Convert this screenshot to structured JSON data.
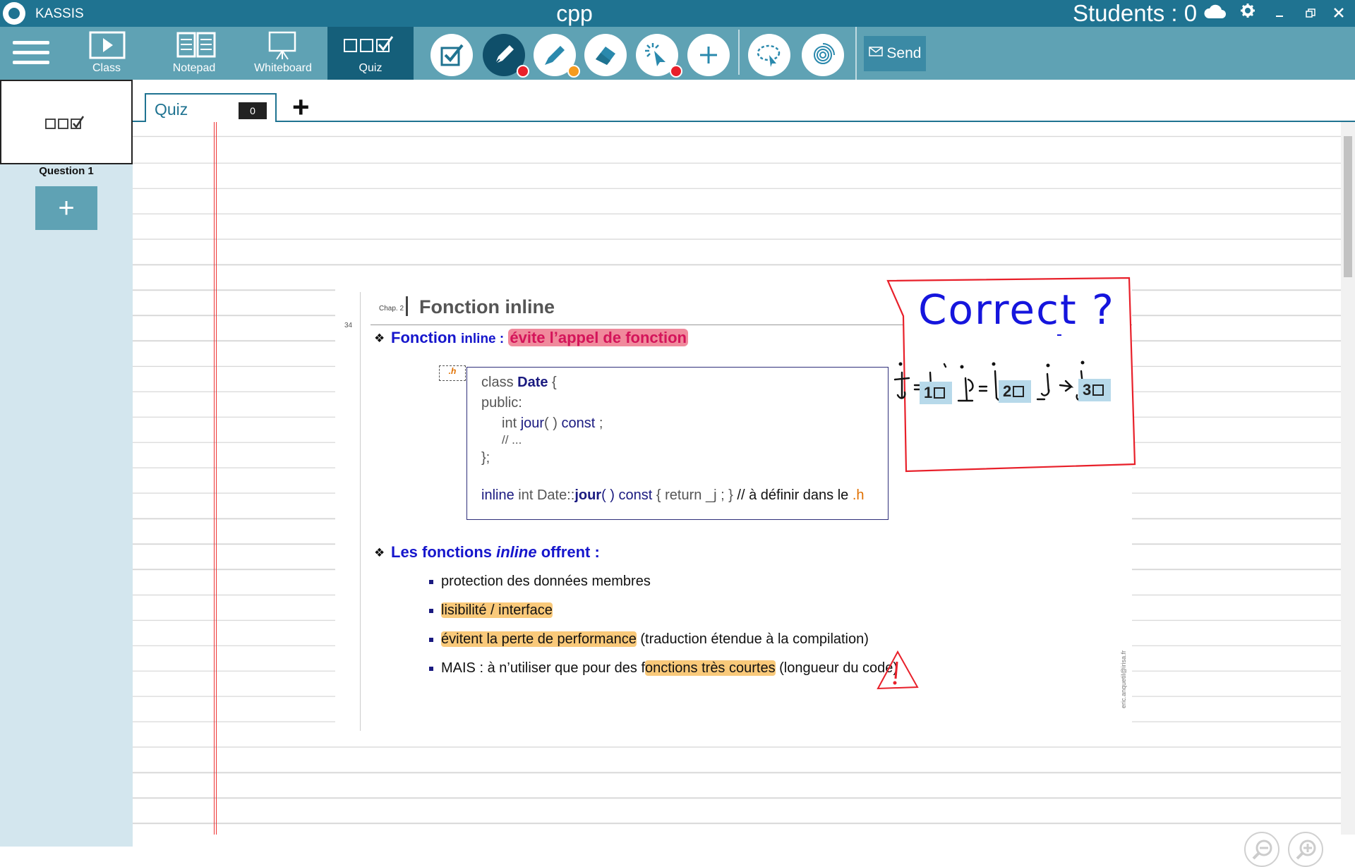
{
  "titlebar": {
    "app_name": "KASSIS",
    "doc_title": "cpp",
    "students_label": "Students : 0"
  },
  "toolbar": {
    "modes": [
      {
        "label": "Class",
        "icon": "play-icon"
      },
      {
        "label": "Notepad",
        "icon": "notepad-icon"
      },
      {
        "label": "Whiteboard",
        "icon": "whiteboard-icon"
      },
      {
        "label": "Quiz",
        "icon": "quiz-icon"
      }
    ],
    "active_mode": "Quiz",
    "tools": [
      {
        "name": "checkbox-tool-icon"
      },
      {
        "name": "pen-tool-icon",
        "dot_color": "#e8202a"
      },
      {
        "name": "highlighter-tool-icon",
        "dot_color": "#f59b1e"
      },
      {
        "name": "eraser-tool-icon"
      },
      {
        "name": "pointer-tool-icon",
        "dot_color": "#e8202a"
      },
      {
        "name": "add-tool-icon"
      },
      {
        "name": "lasso-tool-icon"
      },
      {
        "name": "fingerprint-tool-icon"
      }
    ],
    "send_label": "Send"
  },
  "sidebar": {
    "questions": [
      {
        "label": "Question 1"
      }
    ],
    "add_label": "+"
  },
  "tabs": {
    "items": [
      {
        "label": "Quiz",
        "count": "0"
      }
    ],
    "add_label": "+"
  },
  "slide": {
    "chap": "Chap. 2",
    "title": "Fonction inline",
    "page_number": "34",
    "heading1": {
      "part1": "Fonction",
      "part2": "inline :",
      "highlight": "évite l’appel de fonction"
    },
    "file_tag": ".h",
    "code": {
      "line1_a": "class ",
      "line1_b": "Date",
      "line1_c": " {",
      "line2": "public:",
      "line3_a": "int ",
      "line3_b": "jour",
      "line3_c": "( ) ",
      "line3_d": "const",
      "line3_e": " ;",
      "line4": "// ...",
      "line5": "};",
      "line6_a": "inline",
      "line6_b": "  int Date::",
      "line6_c": "jour",
      "line6_d": "( ) ",
      "line6_e": "const",
      "line6_f": " { return  _j  ; }  ",
      "line6_g": "// à définir dans le ",
      "line6_h": ".h"
    },
    "heading2": {
      "part1": "Les fonctions ",
      "part2": "inline",
      "part3": " offrent :"
    },
    "list": [
      {
        "text": "protection des données membres",
        "highlight": ""
      },
      {
        "text": "",
        "highlight": "lisibilité / interface"
      },
      {
        "text": " (traduction étendue à la compilation)",
        "highlight": "évitent la perte de performance"
      },
      {
        "prefix": "MAIS : à n’utiliser que pour des f",
        "highlight": "onctions très courtes",
        "text": " (longueur du code)"
      }
    ],
    "email": "eric.anquetil@irisa.fr"
  },
  "annotation": {
    "label": "Correct ?",
    "options": [
      "1",
      "2",
      "3"
    ]
  },
  "colors": {
    "titlebar": "#1f7391",
    "toolbar": "#5fa2b4",
    "sidebar": "#d3e6ee",
    "ink_red": "#e8202a",
    "ink_blue": "#1515dd"
  }
}
